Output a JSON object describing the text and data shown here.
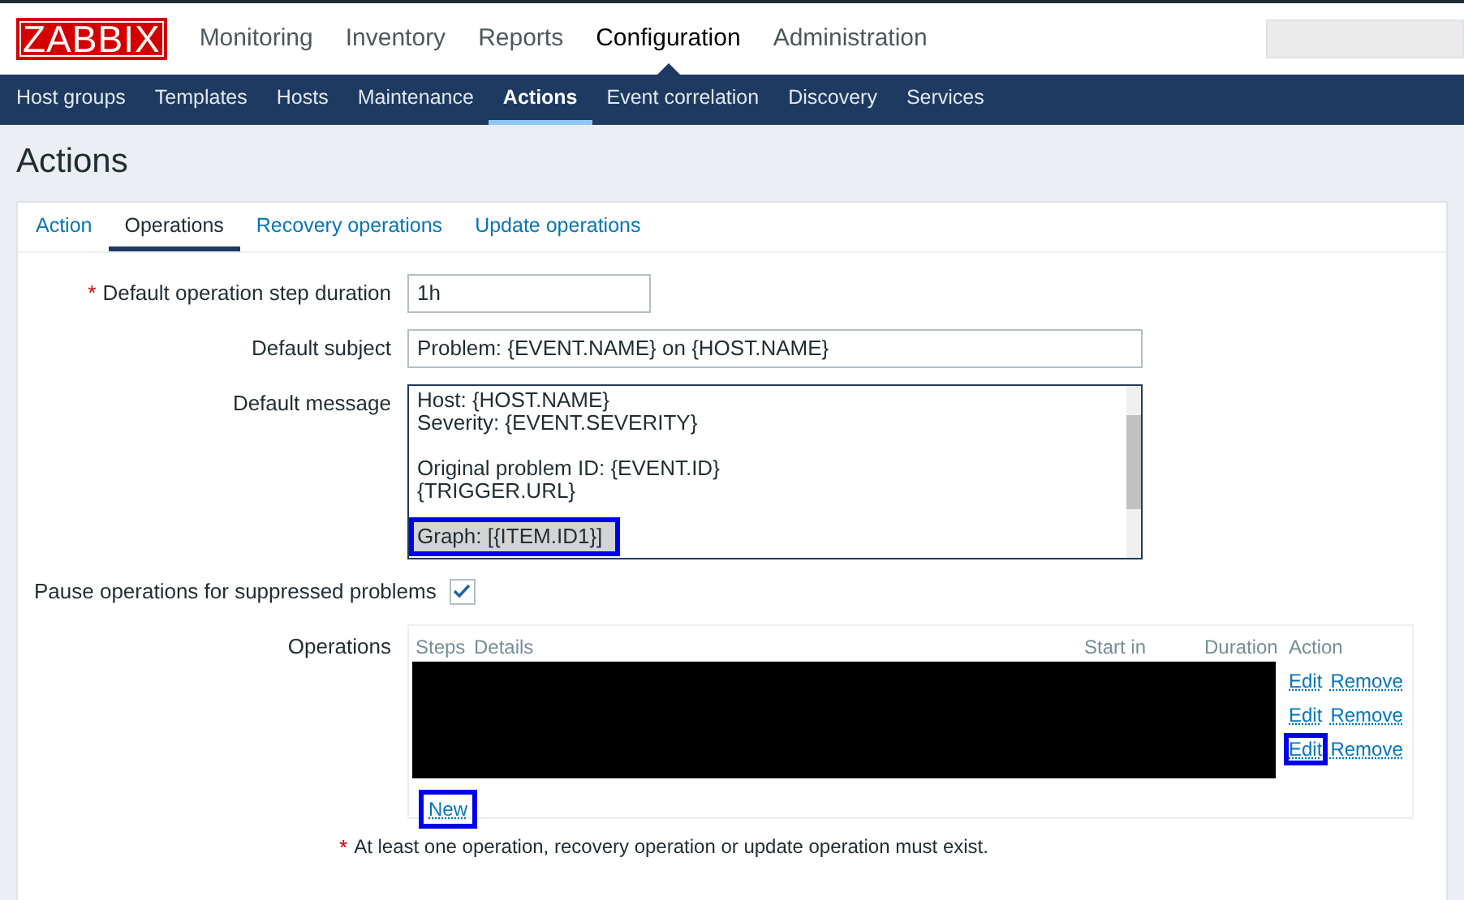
{
  "logo": "ZABBIX",
  "main_menu": [
    {
      "label": "Monitoring",
      "selected": false
    },
    {
      "label": "Inventory",
      "selected": false
    },
    {
      "label": "Reports",
      "selected": false
    },
    {
      "label": "Configuration",
      "selected": true
    },
    {
      "label": "Administration",
      "selected": false
    }
  ],
  "sub_menu": [
    {
      "label": "Host groups",
      "selected": false
    },
    {
      "label": "Templates",
      "selected": false
    },
    {
      "label": "Hosts",
      "selected": false
    },
    {
      "label": "Maintenance",
      "selected": false
    },
    {
      "label": "Actions",
      "selected": true
    },
    {
      "label": "Event correlation",
      "selected": false
    },
    {
      "label": "Discovery",
      "selected": false
    },
    {
      "label": "Services",
      "selected": false
    }
  ],
  "page_title": "Actions",
  "tabs": [
    {
      "label": "Action",
      "selected": false
    },
    {
      "label": "Operations",
      "selected": true
    },
    {
      "label": "Recovery operations",
      "selected": false
    },
    {
      "label": "Update operations",
      "selected": false
    }
  ],
  "form": {
    "required_mark": "*",
    "step_duration": {
      "label": "Default operation step duration",
      "required": true,
      "value": "1h"
    },
    "subject": {
      "label": "Default subject",
      "value": "Problem: {EVENT.NAME} on {HOST.NAME}"
    },
    "message": {
      "label": "Default message",
      "paragraphs": [
        {
          "lines": [
            {
              "text": "Host: {HOST.NAME}",
              "highlighted": false
            },
            {
              "text": "Severity: {EVENT.SEVERITY}",
              "highlighted": false
            }
          ]
        },
        {
          "lines": [
            {
              "text": "Original problem ID: {EVENT.ID}",
              "highlighted": false
            },
            {
              "text": "{TRIGGER.URL}",
              "highlighted": false
            }
          ]
        },
        {
          "lines": [
            {
              "text": "Graph: [{ITEM.ID1}]",
              "highlighted": true
            }
          ]
        }
      ]
    },
    "pause": {
      "label": "Pause operations for suppressed problems",
      "checked": true
    },
    "operations": {
      "label": "Operations",
      "columns": [
        "Steps",
        "Details",
        "Start in",
        "Duration",
        "Action"
      ],
      "rows": [
        {
          "edit": "Edit",
          "remove": "Remove",
          "highlighted": false
        },
        {
          "edit": "Edit",
          "remove": "Remove",
          "highlighted": false
        },
        {
          "edit": "Edit",
          "remove": "Remove",
          "highlighted": true
        }
      ],
      "new": {
        "label": "New",
        "highlighted": true
      }
    },
    "note": "At least one operation, recovery operation or update operation must exist."
  }
}
